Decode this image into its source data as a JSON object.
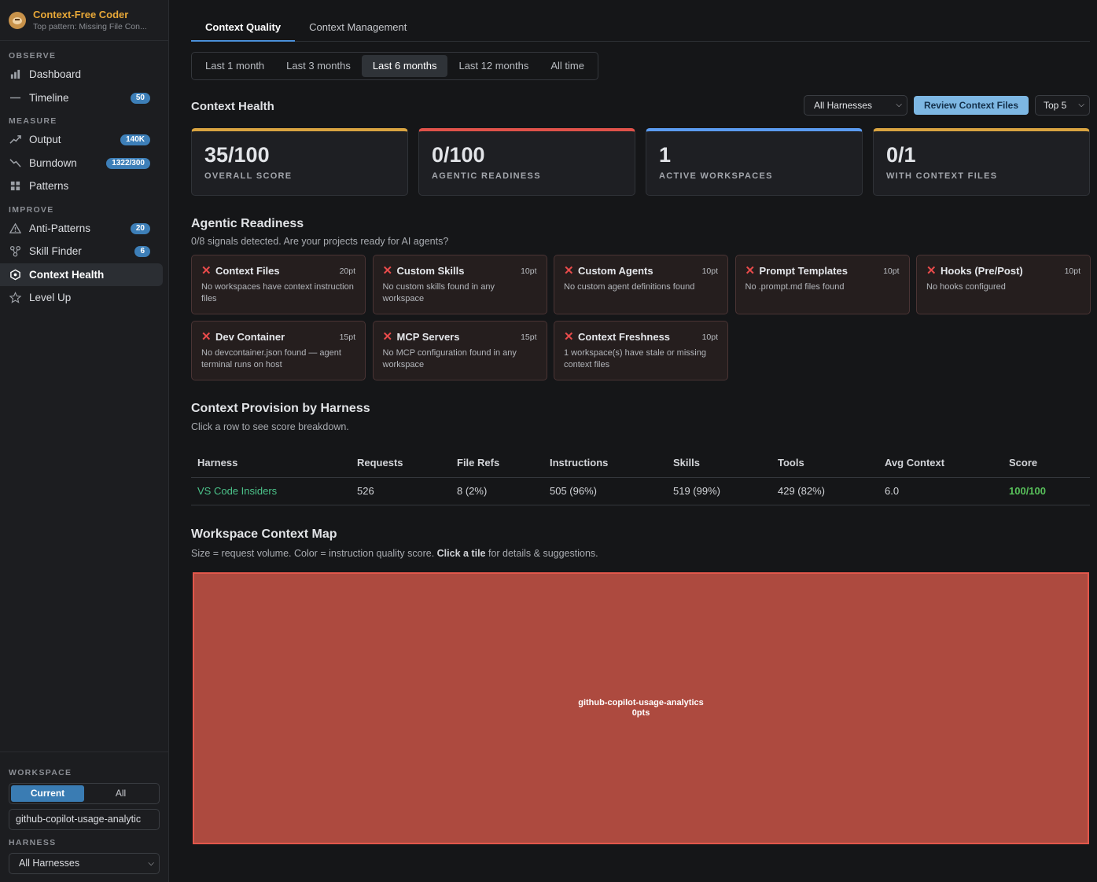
{
  "brand": {
    "name": "Context-Free Coder",
    "subtitle": "Top pattern: Missing File Con..."
  },
  "sidebar": {
    "observe_label": "OBSERVE",
    "measure_label": "MEASURE",
    "improve_label": "IMPROVE",
    "items": [
      {
        "label": "Dashboard",
        "icon": "bar-chart-icon",
        "badge": ""
      },
      {
        "label": "Timeline",
        "icon": "line-dash-icon",
        "badge": "50"
      },
      {
        "label": "Output",
        "icon": "trend-up-icon",
        "badge": "140K"
      },
      {
        "label": "Burndown",
        "icon": "trend-down-icon",
        "badge": "1322/300"
      },
      {
        "label": "Patterns",
        "icon": "grid-icon",
        "badge": ""
      },
      {
        "label": "Anti-Patterns",
        "icon": "warning-icon",
        "badge": "20"
      },
      {
        "label": "Skill Finder",
        "icon": "network-icon",
        "badge": "6"
      },
      {
        "label": "Context Health",
        "icon": "hexagon-icon",
        "badge": ""
      },
      {
        "label": "Level Up",
        "icon": "star-icon",
        "badge": ""
      }
    ],
    "workspace_label": "WORKSPACE",
    "workspace_toggle": {
      "current": "Current",
      "all": "All"
    },
    "workspace_value": "github-copilot-usage-analytic",
    "harness_label": "HARNESS",
    "harness_value": "All Harnesses"
  },
  "tabs": [
    "Context Quality",
    "Context Management"
  ],
  "ranges": [
    "Last 1 month",
    "Last 3 months",
    "Last 6 months",
    "Last 12 months",
    "All time"
  ],
  "health": {
    "title": "Context Health",
    "harness_filter": "All Harnesses",
    "review_button": "Review Context Files",
    "top_select": "Top 5"
  },
  "colors": {
    "yellow": "#d9a441",
    "red": "#e0524a",
    "blue": "#5b9bf0"
  },
  "cards": [
    {
      "value": "35/100",
      "label": "OVERALL SCORE",
      "color": "#d9a441"
    },
    {
      "value": "0/100",
      "label": "AGENTIC READINESS",
      "color": "#e0524a"
    },
    {
      "value": "1",
      "label": "ACTIVE WORKSPACES",
      "color": "#5b9bf0"
    },
    {
      "value": "0/1",
      "label": "WITH CONTEXT FILES",
      "color": "#d9a441"
    }
  ],
  "readiness": {
    "title": "Agentic Readiness",
    "desc": "0/8 signals detected. Are your projects ready for AI agents?",
    "signals": [
      {
        "title": "Context Files",
        "pts": "20pt",
        "desc": "No workspaces have context instruction files"
      },
      {
        "title": "Custom Skills",
        "pts": "10pt",
        "desc": "No custom skills found in any workspace"
      },
      {
        "title": "Custom Agents",
        "pts": "10pt",
        "desc": "No custom agent definitions found"
      },
      {
        "title": "Prompt Templates",
        "pts": "10pt",
        "desc": "No .prompt.md files found"
      },
      {
        "title": "Hooks (Pre/Post)",
        "pts": "10pt",
        "desc": "No hooks configured"
      },
      {
        "title": "Dev Container",
        "pts": "15pt",
        "desc": "No devcontainer.json found — agent terminal runs on host"
      },
      {
        "title": "MCP Servers",
        "pts": "15pt",
        "desc": "No MCP configuration found in any workspace"
      },
      {
        "title": "Context Freshness",
        "pts": "10pt",
        "desc": "1 workspace(s) have stale or missing context files"
      }
    ]
  },
  "provision": {
    "title": "Context Provision by Harness",
    "desc": "Click a row to see score breakdown.",
    "columns": [
      "Harness",
      "Requests",
      "File Refs",
      "Instructions",
      "Skills",
      "Tools",
      "Avg Context",
      "Score"
    ],
    "rows": [
      [
        "VS Code Insiders",
        "526",
        "8 (2%)",
        "505 (96%)",
        "519 (99%)",
        "429 (82%)",
        "6.0",
        "100/100"
      ]
    ]
  },
  "map": {
    "title": "Workspace Context Map",
    "desc_a": "Size = request volume. Color = instruction quality score. ",
    "desc_bold": "Click a tile",
    "desc_b": " for details & suggestions.",
    "tile_name": "github-copilot-usage-analytics",
    "tile_pts": "0pts"
  }
}
